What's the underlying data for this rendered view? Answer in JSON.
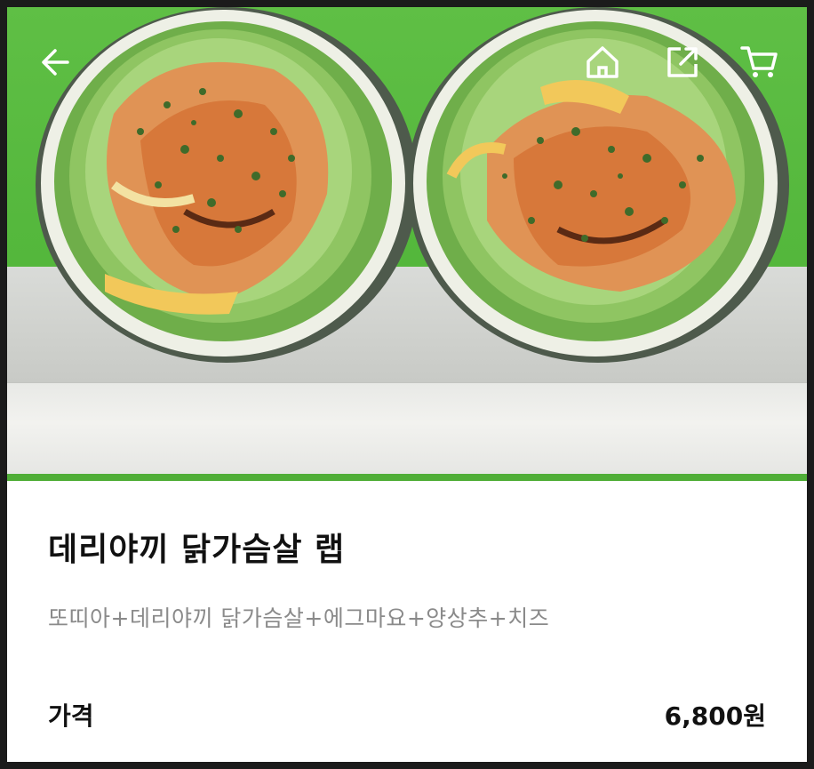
{
  "header": {
    "icons": {
      "back": "arrow-left-icon",
      "home": "home-icon",
      "share": "share-icon",
      "cart": "cart-icon"
    }
  },
  "product": {
    "title": "데리야끼 닭가슴살 랩",
    "description": "또띠아+데리야끼 닭가슴살+에그마요+양상추+치즈",
    "price_label": "가격",
    "price_value": "6,800원"
  }
}
